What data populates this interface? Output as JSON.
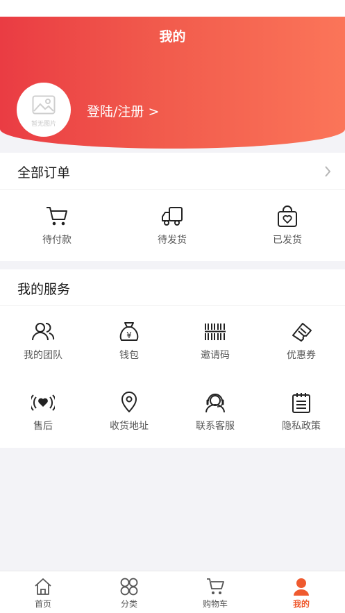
{
  "header": {
    "title": "我的",
    "avatar_caption": "暂无图片",
    "login_label": "登陆/注册 >"
  },
  "orders": {
    "title": "全部订单",
    "items": [
      {
        "label": "待付款",
        "icon": "cart-icon"
      },
      {
        "label": "待发货",
        "icon": "truck-icon"
      },
      {
        "label": "已发货",
        "icon": "shopping-bag-icon"
      }
    ]
  },
  "services": {
    "title": "我的服务",
    "items": [
      {
        "label": "我的团队",
        "icon": "team-icon"
      },
      {
        "label": "钱包",
        "icon": "money-bag-icon"
      },
      {
        "label": "邀请码",
        "icon": "barcode-icon"
      },
      {
        "label": "优惠券",
        "icon": "coupon-icon"
      },
      {
        "label": "售后",
        "icon": "after-sales-icon"
      },
      {
        "label": "收货地址",
        "icon": "location-pin-icon"
      },
      {
        "label": "联系客服",
        "icon": "customer-service-icon"
      },
      {
        "label": "隐私政策",
        "icon": "notepad-icon"
      }
    ]
  },
  "tabbar": {
    "accent": "#ef5a2f",
    "items": [
      {
        "label": "首页",
        "icon": "home-icon"
      },
      {
        "label": "分类",
        "icon": "category-icon"
      },
      {
        "label": "购物车",
        "icon": "cart-icon"
      },
      {
        "label": "我的",
        "icon": "user-icon",
        "active": true
      }
    ]
  }
}
